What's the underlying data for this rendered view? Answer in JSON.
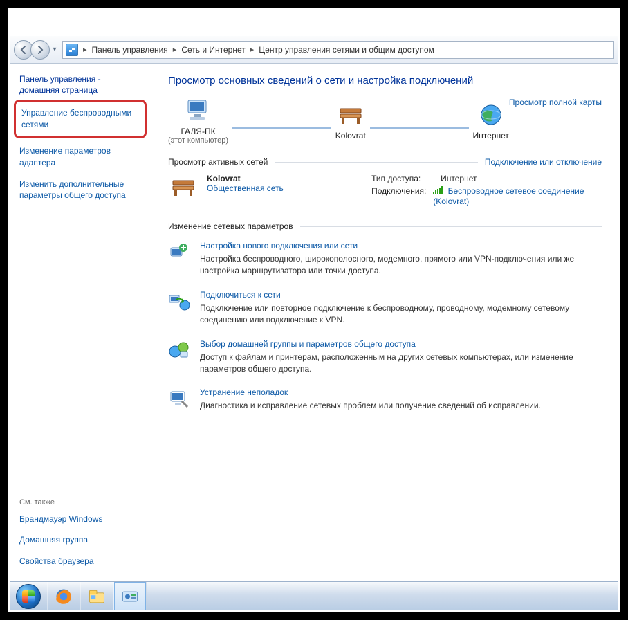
{
  "breadcrumb": {
    "items": [
      "Панель управления",
      "Сеть и Интернет",
      "Центр управления сетями и общим доступом"
    ]
  },
  "sidebar": {
    "home": "Панель управления - домашняя страница",
    "links": [
      "Управление беспроводными сетями",
      "Изменение параметров адаптера",
      "Изменить дополнительные параметры общего доступа"
    ],
    "see_also_label": "См. также",
    "see_also": [
      "Брандмауэр Windows",
      "Домашняя группа",
      "Свойства браузера"
    ]
  },
  "main": {
    "heading": "Просмотр основных сведений о сети и настройка подключений",
    "full_map_link": "Просмотр полной карты",
    "nodes": {
      "pc": "ГАЛЯ-ПК",
      "pc_sub": "(этот компьютер)",
      "network": "Kolovrat",
      "internet": "Интернет"
    },
    "active_section": "Просмотр активных сетей",
    "connect_link": "Подключение или отключение",
    "active": {
      "name": "Kolovrat",
      "type": "Общественная сеть",
      "access_label": "Тип доступа:",
      "access_value": "Интернет",
      "conn_label": "Подключения:",
      "conn_value": "Беспроводное сетевое соединение (Kolovrat)"
    },
    "change_section": "Изменение сетевых параметров",
    "tasks": [
      {
        "title": "Настройка нового подключения или сети",
        "desc": "Настройка беспроводного, широкополосного, модемного, прямого или VPN-подключения или же настройка маршрутизатора или точки доступа."
      },
      {
        "title": "Подключиться к сети",
        "desc": "Подключение или повторное подключение к беспроводному, проводному, модемному сетевому соединению или подключение к VPN."
      },
      {
        "title": "Выбор домашней группы и параметров общего доступа",
        "desc": "Доступ к файлам и принтерам, расположенным на других сетевых компьютерах, или изменение параметров общего доступа."
      },
      {
        "title": "Устранение неполадок",
        "desc": "Диагностика и исправление сетевых проблем или получение сведений об исправлении."
      }
    ]
  }
}
